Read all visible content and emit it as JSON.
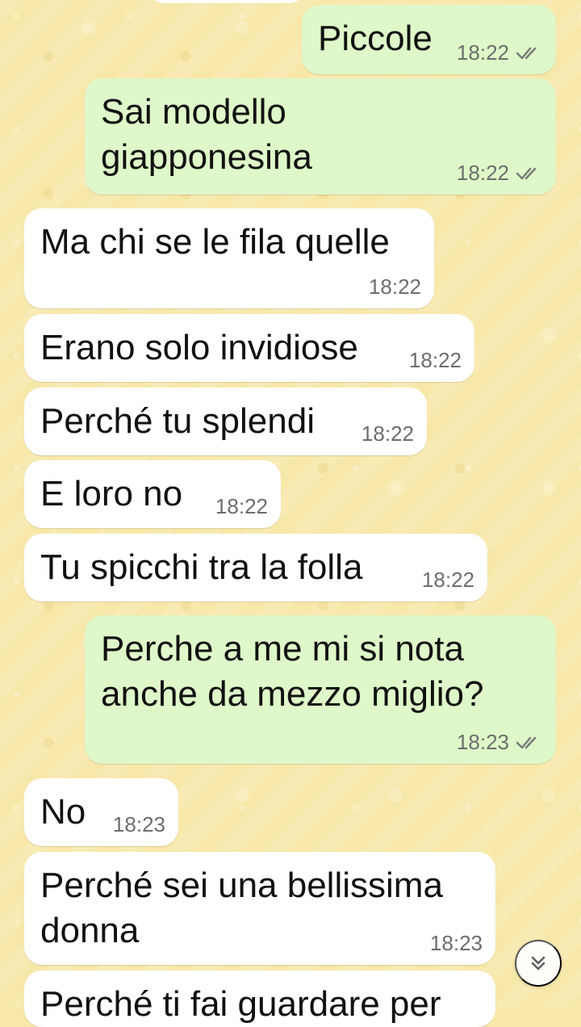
{
  "colors": {
    "wallpaper": "#f7e8a9",
    "incoming_bubble": "#ffffff",
    "outgoing_bubble": "#dff8c9",
    "timestamp": "#6d6d6d",
    "tick": "#7a7a7a"
  },
  "messages": [
    {
      "direction": "outgoing",
      "text": "Piccole",
      "time": "18:22",
      "status_icon": "double-check-icon"
    },
    {
      "direction": "outgoing",
      "text": "Sai modello\ngiapponesina",
      "time": "18:22",
      "status_icon": "double-check-icon"
    },
    {
      "direction": "incoming",
      "text": "Ma chi se le fila quelle",
      "time": "18:22"
    },
    {
      "direction": "incoming",
      "text": "Erano solo invidiose",
      "time": "18:22"
    },
    {
      "direction": "incoming",
      "text": "Perché tu splendi",
      "time": "18:22"
    },
    {
      "direction": "incoming",
      "text": "E loro no",
      "time": "18:22"
    },
    {
      "direction": "incoming",
      "text": "Tu spicchi tra la folla",
      "time": "18:22"
    },
    {
      "direction": "outgoing",
      "text": "Perche a me mi si nota\nanche da mezzo miglio?",
      "time": "18:23",
      "status_icon": "double-check-icon"
    },
    {
      "direction": "incoming",
      "text": "No",
      "time": "18:23"
    },
    {
      "direction": "incoming",
      "text": "Perché sei una bellissima\ndonna",
      "time": "18:23"
    },
    {
      "direction": "incoming",
      "text": "Perché ti fai guardare per"
    }
  ],
  "scroll_button": {
    "icon": "double-chevron-down-icon"
  }
}
